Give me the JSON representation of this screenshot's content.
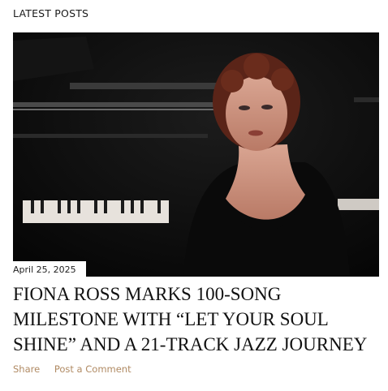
{
  "section": {
    "title": "LATEST POSTS"
  },
  "post": {
    "date": "April 25, 2025",
    "title": "FIONA ROSS MARKS 100-SONG MILESTONE WITH “LET YOUR SOUL SHINE” AND A 21-TRACK JAZZ JOURNEY",
    "image_alt": "Fiona Ross at the piano"
  },
  "actions": {
    "share_label": "Share",
    "comment_label": "Post a Comment"
  }
}
